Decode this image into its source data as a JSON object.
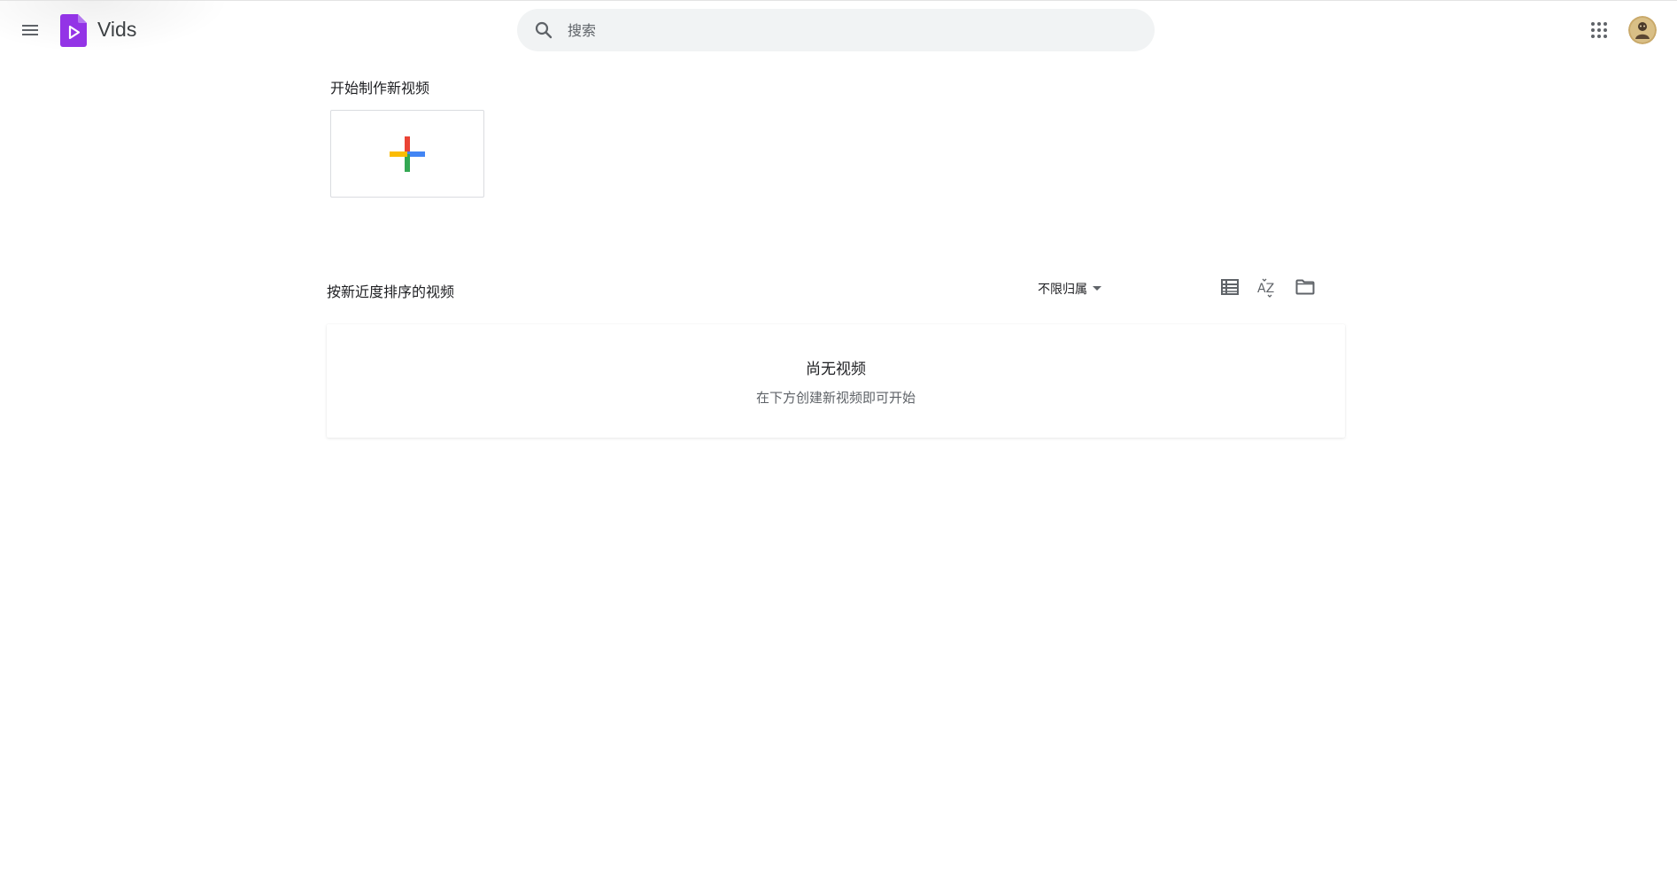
{
  "app": {
    "title": "Vids",
    "brand_color": "#9334e6"
  },
  "header": {
    "menu_icon": "hamburger-menu-icon",
    "search": {
      "placeholder": "搜索",
      "value": ""
    },
    "apps_icon": "apps-grid-icon",
    "avatar_icon": "user-avatar"
  },
  "start_section": {
    "title": "开始制作新视频",
    "new_card_icon": "colorful-plus-icon",
    "plus_colors": {
      "top": "#ea4335",
      "right": "#4285f4",
      "bottom": "#34a853",
      "left": "#fbbc04"
    }
  },
  "recent_section": {
    "title": "按新近度排序的视频",
    "owner_filter": {
      "label": "不限归属"
    },
    "tools": {
      "list_view_icon": "list-view-icon",
      "sort_icon": "sort-az-icon",
      "sort_label": "AZ",
      "folder_icon": "folder-icon"
    },
    "empty_state": {
      "title": "尚无视频",
      "subtitle": "在下方创建新视频即可开始"
    }
  }
}
